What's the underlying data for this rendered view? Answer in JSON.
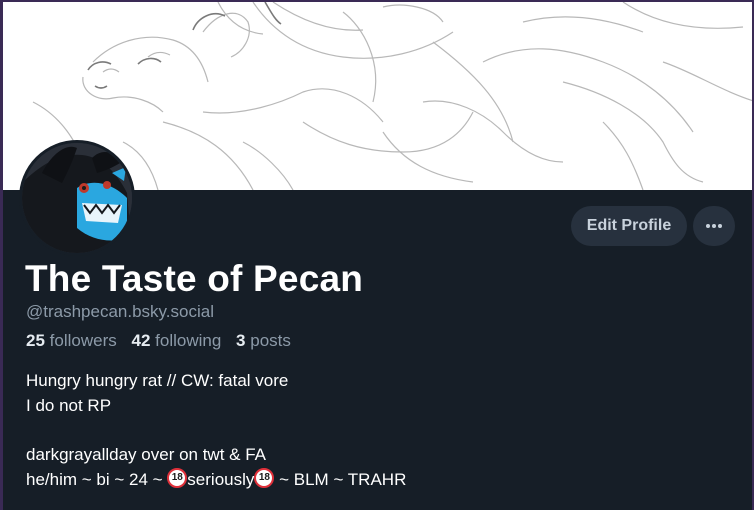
{
  "profile": {
    "display_name": "The Taste of Pecan",
    "handle": "@trashpecan.bsky.social",
    "followers_count": "25",
    "followers_label": "followers",
    "following_count": "42",
    "following_label": "following",
    "posts_count": "3",
    "posts_label": "posts"
  },
  "actions": {
    "edit_profile_label": "Edit Profile",
    "more_icon": "ellipsis-icon"
  },
  "bio": {
    "line1": "Hungry hungry rat // CW: fatal vore",
    "line2": "I do not RP",
    "line3": "darkgrayallday over on twt & FA",
    "line4_a": "he/him ~ bi ~ 24 ~ ",
    "line4_badge": "18",
    "line4_b": "seriously",
    "line4_c": " ~ BLM ~ TRAHR"
  },
  "colors": {
    "background": "#161e27",
    "button_bg": "#27313e",
    "muted_text": "#8c9aa8",
    "primary_text": "#ffffff",
    "avatar_accent": "#2aa7e0"
  }
}
